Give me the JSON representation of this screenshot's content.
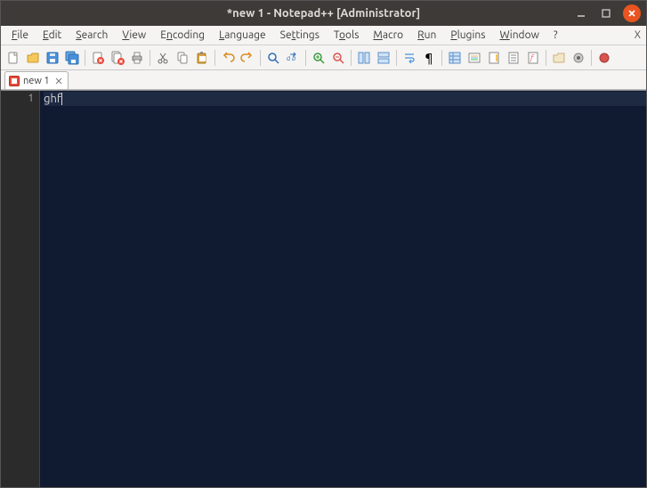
{
  "title": "*new 1 - Notepad++ [Administrator]",
  "menu": {
    "file": "File",
    "edit": "Edit",
    "search": "Search",
    "view": "View",
    "encoding": "Encoding",
    "language": "Language",
    "settings": "Settings",
    "tools": "Tools",
    "macro": "Macro",
    "run": "Run",
    "plugins": "Plugins",
    "window": "Window",
    "help": "?"
  },
  "tab": {
    "label": "new 1"
  },
  "editor": {
    "line_number": "1",
    "content": "ghf"
  }
}
